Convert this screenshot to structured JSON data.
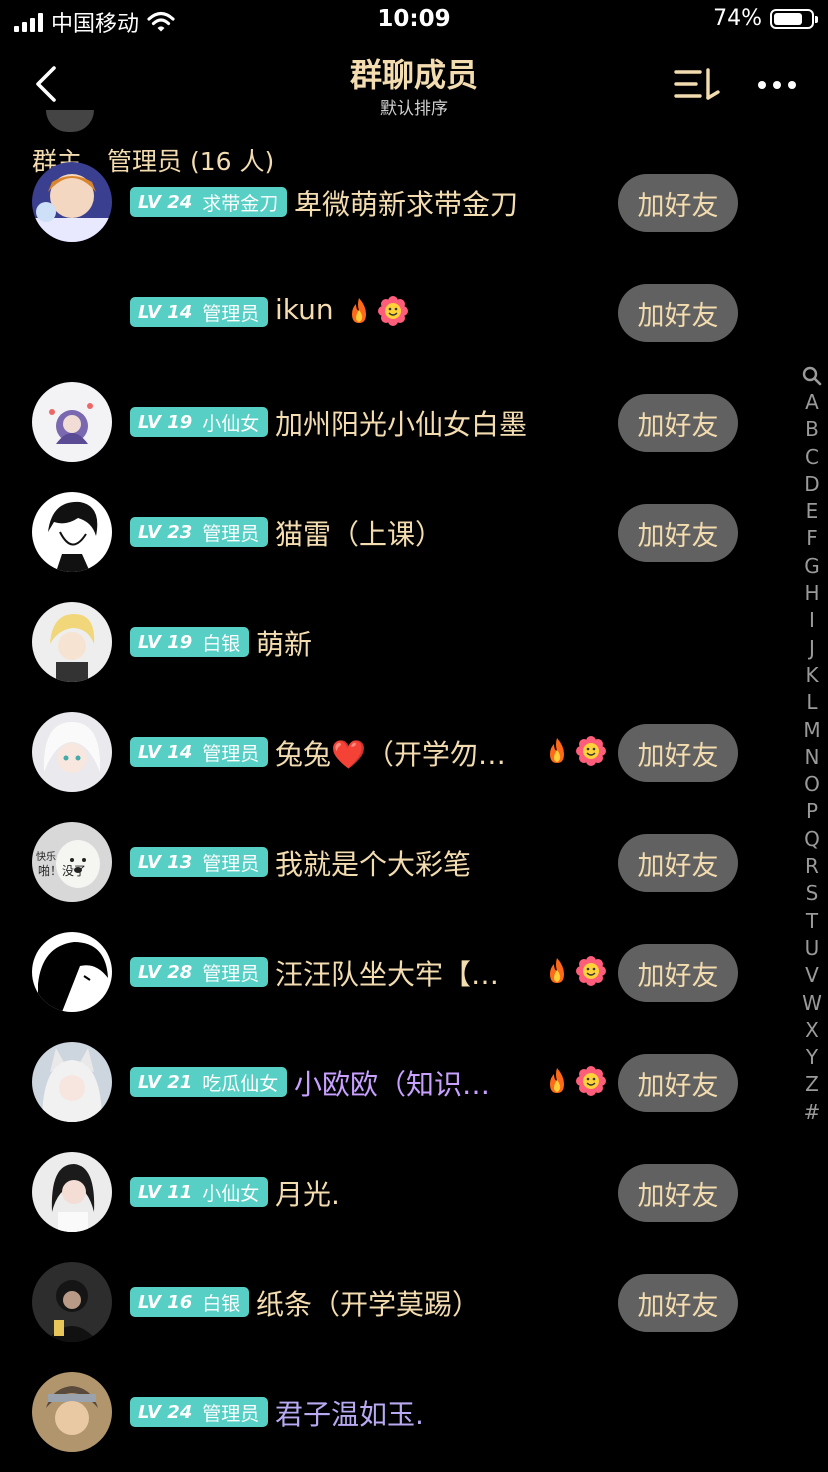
{
  "status_bar": {
    "carrier": "中国移动",
    "time": "10:09",
    "battery": "74%"
  },
  "header": {
    "title": "群聊成员",
    "subtitle": "默认排序"
  },
  "section": {
    "title": "群主、管理员 (16 人)"
  },
  "add_friend_label": "加好友",
  "members": [
    {
      "level": "LV 24",
      "role": "求带金刀",
      "name": "卑微萌新求带金刀",
      "color": "#f3dcaf",
      "emojis": false,
      "add": true,
      "avatar": "anime"
    },
    {
      "level": "LV 14",
      "role": "管理员",
      "name": "ikun",
      "color": "#f3dcaf",
      "emojis": true,
      "add": true,
      "avatar": "none"
    },
    {
      "level": "LV 19",
      "role": "小仙女",
      "name": "加州阳光小仙女白墨",
      "color": "#f3dcaf",
      "emojis": false,
      "add": true,
      "avatar": "white"
    },
    {
      "level": "LV 23",
      "role": "管理员",
      "name": "猫雷（上课）",
      "color": "#f3dcaf",
      "emojis": false,
      "add": true,
      "avatar": "sketch"
    },
    {
      "level": "LV 19",
      "role": "白银",
      "name": "萌新",
      "color": "#f3dcaf",
      "emojis": false,
      "add": false,
      "avatar": "blonde"
    },
    {
      "level": "LV 14",
      "role": "管理员",
      "name": "兔兔❤️（开学勿…",
      "color": "#f3dcaf",
      "emojis": true,
      "add": true,
      "avatar": "whitehair"
    },
    {
      "level": "LV 13",
      "role": "管理员",
      "name": "我就是个大彩笔",
      "color": "#f3dcaf",
      "emojis": false,
      "add": true,
      "avatar": "dog",
      "avatar_text": [
        "快乐",
        "啪！没了"
      ]
    },
    {
      "level": "LV 28",
      "role": "管理员",
      "name": "汪汪队坐大牢【…",
      "color": "#f3dcaf",
      "emojis": true,
      "add": true,
      "avatar": "silhouette"
    },
    {
      "level": "LV 21",
      "role": "吃瓜仙女",
      "name": "小欧欧（知识…",
      "color": "#c8a0ff",
      "emojis": true,
      "add": true,
      "avatar": "fox"
    },
    {
      "level": "LV 11",
      "role": "小仙女",
      "name": "月光.",
      "color": "#f3dcaf",
      "emojis": false,
      "add": true,
      "avatar": "girl"
    },
    {
      "level": "LV 16",
      "role": "白银",
      "name": "纸条（开学莫踢）",
      "color": "#f3dcaf",
      "emojis": false,
      "add": true,
      "avatar": "dark"
    },
    {
      "level": "LV 24",
      "role": "管理员",
      "name": "君子温如玉.",
      "color": "#b9a9f0",
      "emojis": false,
      "add": false,
      "avatar": "naruto"
    }
  ],
  "index_letters": [
    "A",
    "B",
    "C",
    "D",
    "E",
    "F",
    "G",
    "H",
    "I",
    "J",
    "K",
    "L",
    "M",
    "N",
    "O",
    "P",
    "Q",
    "R",
    "S",
    "T",
    "U",
    "V",
    "W",
    "X",
    "Y",
    "Z",
    "#"
  ],
  "colors": {
    "accent": "#f3dcaf",
    "badge": "#57cfc4",
    "button_bg": "#616161",
    "background": "#000000"
  }
}
